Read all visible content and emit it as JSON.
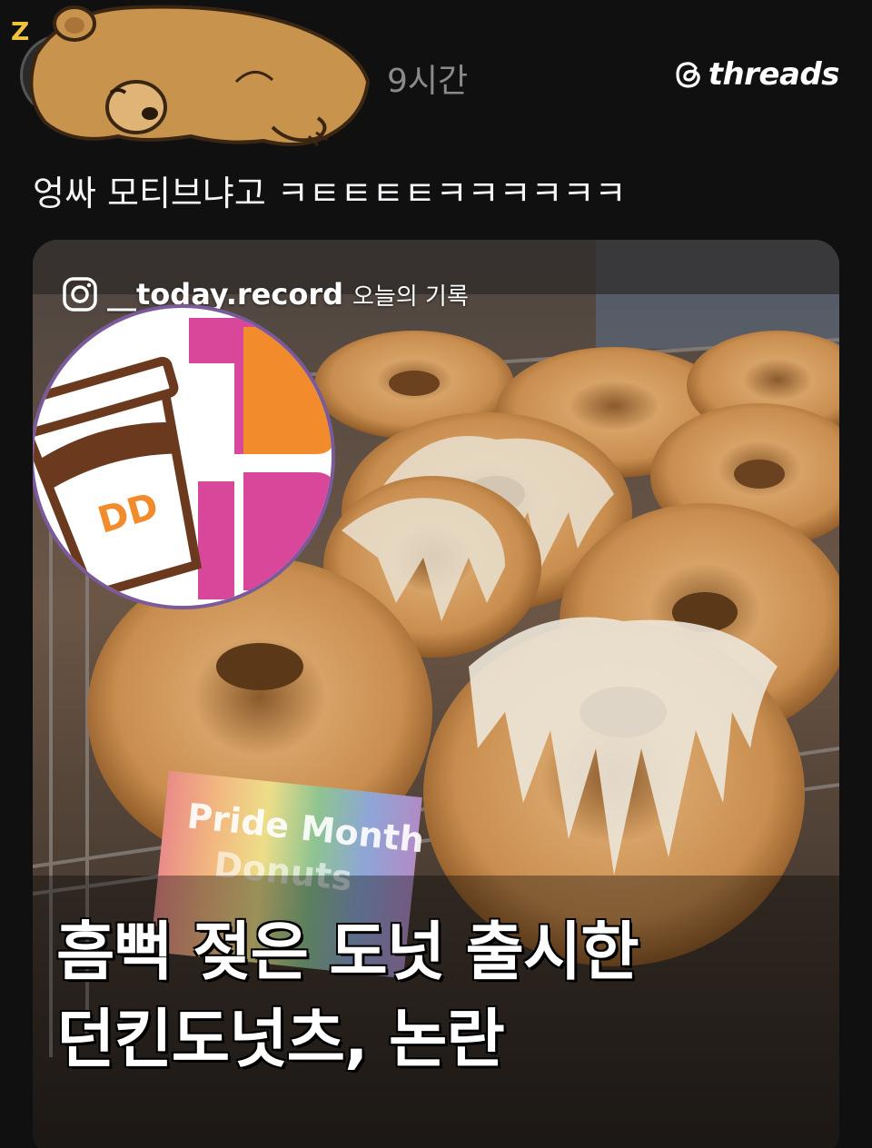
{
  "header": {
    "username_tail": "",
    "timestamp": "9시간",
    "brand": "threads"
  },
  "post": {
    "text": "엉싸 모티브냐고 ㅋㅌㅌㅌㅌㅋㅋㅋㅋㅋㅋ"
  },
  "media": {
    "ig_handle": "__today.record",
    "ig_caption": "오늘의 기록",
    "sign_text": "Pride Month Donuts",
    "headline_line1": "흠뻑 젖은 도넛 출시한",
    "headline_line2": "던킨도넛츠, 논란",
    "logo_text": "DD"
  },
  "colors": {
    "background": "#101010",
    "text": "#f3f5f7",
    "muted": "#8a8a8a",
    "dd_pink": "#d9479a",
    "dd_orange": "#f18b2b"
  }
}
